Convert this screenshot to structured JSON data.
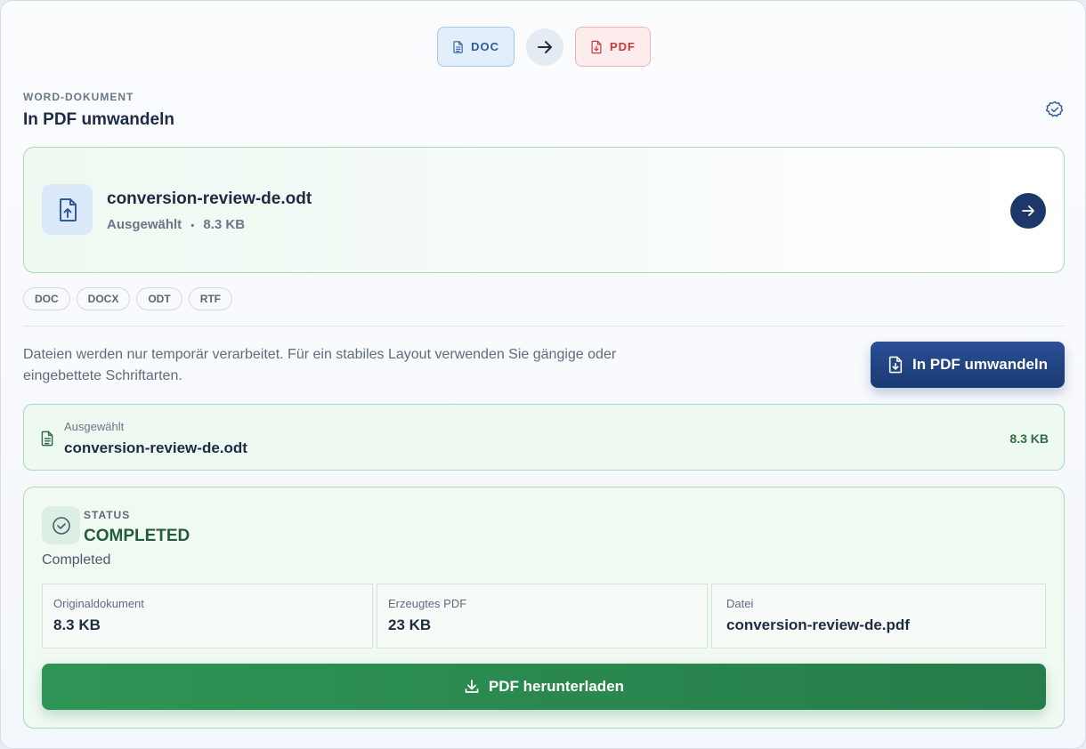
{
  "flow": {
    "from_label": "DOC",
    "to_label": "PDF",
    "from_icon": "document-icon",
    "to_icon": "pdf-download-icon",
    "arrow_icon": "arrow-right-icon"
  },
  "header": {
    "eyebrow": "WORD-DOKUMENT",
    "title": "In PDF umwandeln",
    "badge_icon": "verified-badge-icon"
  },
  "dropzone": {
    "file_name": "conversion-review-de.odt",
    "state": "Ausgewählt",
    "separator": "•",
    "size": "8.3 KB",
    "icon": "file-upload-icon"
  },
  "formats": [
    "DOC",
    "DOCX",
    "ODT",
    "RTF"
  ],
  "note": "Dateien werden nur temporär verarbeitet. Für ein stabiles Layout verwenden Sie gängige oder eingebettete Schriftarten.",
  "convert_button": {
    "label": "In PDF umwandeln"
  },
  "selected": {
    "label": "Ausgewählt",
    "file_name": "conversion-review-de.odt",
    "size": "8.3 KB"
  },
  "status": {
    "label": "STATUS",
    "value": "COMPLETED",
    "description": "Completed",
    "stats": [
      {
        "key": "Originaldokument",
        "value": "8.3 KB"
      },
      {
        "key": "Erzeugtes PDF",
        "value": "23 KB"
      },
      {
        "key": "Datei",
        "value": "conversion-review-de.pdf"
      }
    ],
    "download_label": "PDF herunterladen"
  },
  "colors": {
    "primary": "#1d3868",
    "success": "#2e9455",
    "doc_accent": "#2d5d9f",
    "pdf_accent": "#c33c3c"
  }
}
